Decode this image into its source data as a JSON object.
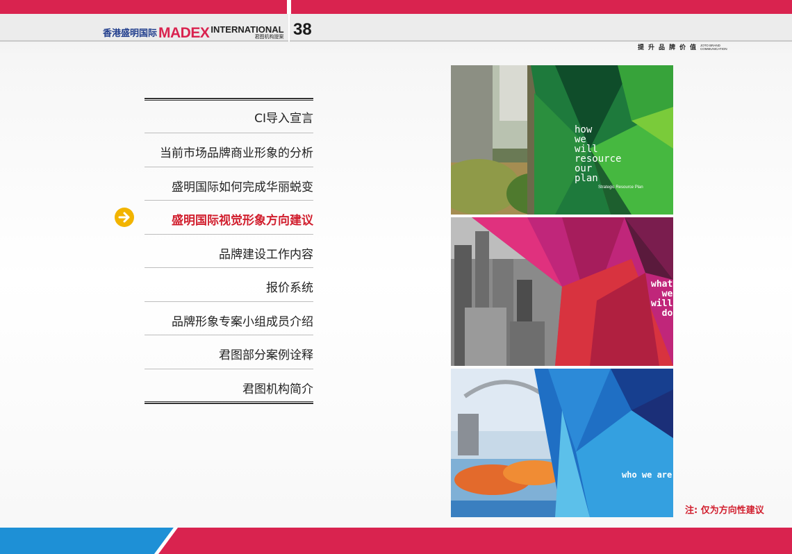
{
  "header": {
    "brand_cn": "香港盛明国际",
    "brand_madex": "MADEX",
    "brand_international": "INTERNATIONAL",
    "brand_subtitle": "君图机构提案",
    "page_number": "38",
    "tagline_cn": "提升品牌价值",
    "tagline_en_1": "JOTO BRAND",
    "tagline_en_2": "COMMUNICATION"
  },
  "menu": {
    "items": [
      {
        "label": "CI导入宣言"
      },
      {
        "label": "当前市场品牌商业形象的分析"
      },
      {
        "label": "盛明国际如何完成华丽蜕变"
      },
      {
        "label": "盛明国际视觉形象方向建议"
      },
      {
        "label": "品牌建设工作内容"
      },
      {
        "label": "报价系统"
      },
      {
        "label": "品牌形象专案小组成员介绍"
      },
      {
        "label": "君图部分案例诠释"
      },
      {
        "label": "君图机构简介"
      }
    ],
    "active_index": 3
  },
  "panels": {
    "p1_text": "how\nwe\nwill\nresource\nour\nplan",
    "p1_caption": "Strategic Resource Plan",
    "p2_text": "what\n  we\nwill\n  do",
    "p3_text": "who we are"
  },
  "note": "注: 仅为方向性建议",
  "colors": {
    "accent_red": "#d9234f",
    "accent_blue": "#1e90d6",
    "highlight_red": "#d11f2e",
    "arrow_yellow": "#f2b400"
  }
}
